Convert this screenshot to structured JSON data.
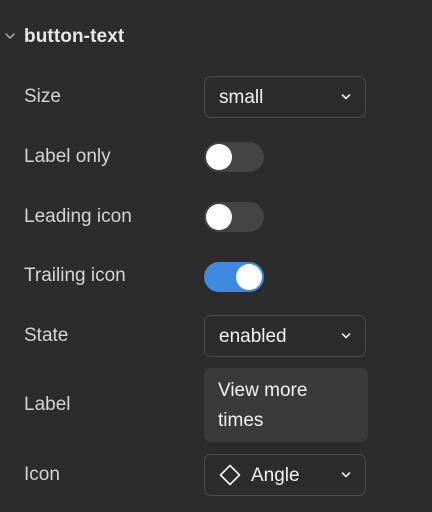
{
  "section": {
    "title": "button-text"
  },
  "rows": {
    "size": {
      "label": "Size",
      "value": "small"
    },
    "label_only": {
      "label": "Label only",
      "checked": false
    },
    "leading_icon": {
      "label": "Leading icon",
      "checked": false
    },
    "trailing_icon": {
      "label": "Trailing icon",
      "checked": true
    },
    "state": {
      "label": "State",
      "value": "enabled"
    },
    "label_text": {
      "label": "Label",
      "value": "View more times"
    },
    "icon": {
      "label": "Icon",
      "value": "Angle",
      "icon_name": "diamond-icon"
    }
  },
  "colors": {
    "background": "#2c2c2c",
    "toggle_on": "#3d8ae0",
    "toggle_off": "#444444",
    "textarea_bg": "#3a3a3a"
  }
}
